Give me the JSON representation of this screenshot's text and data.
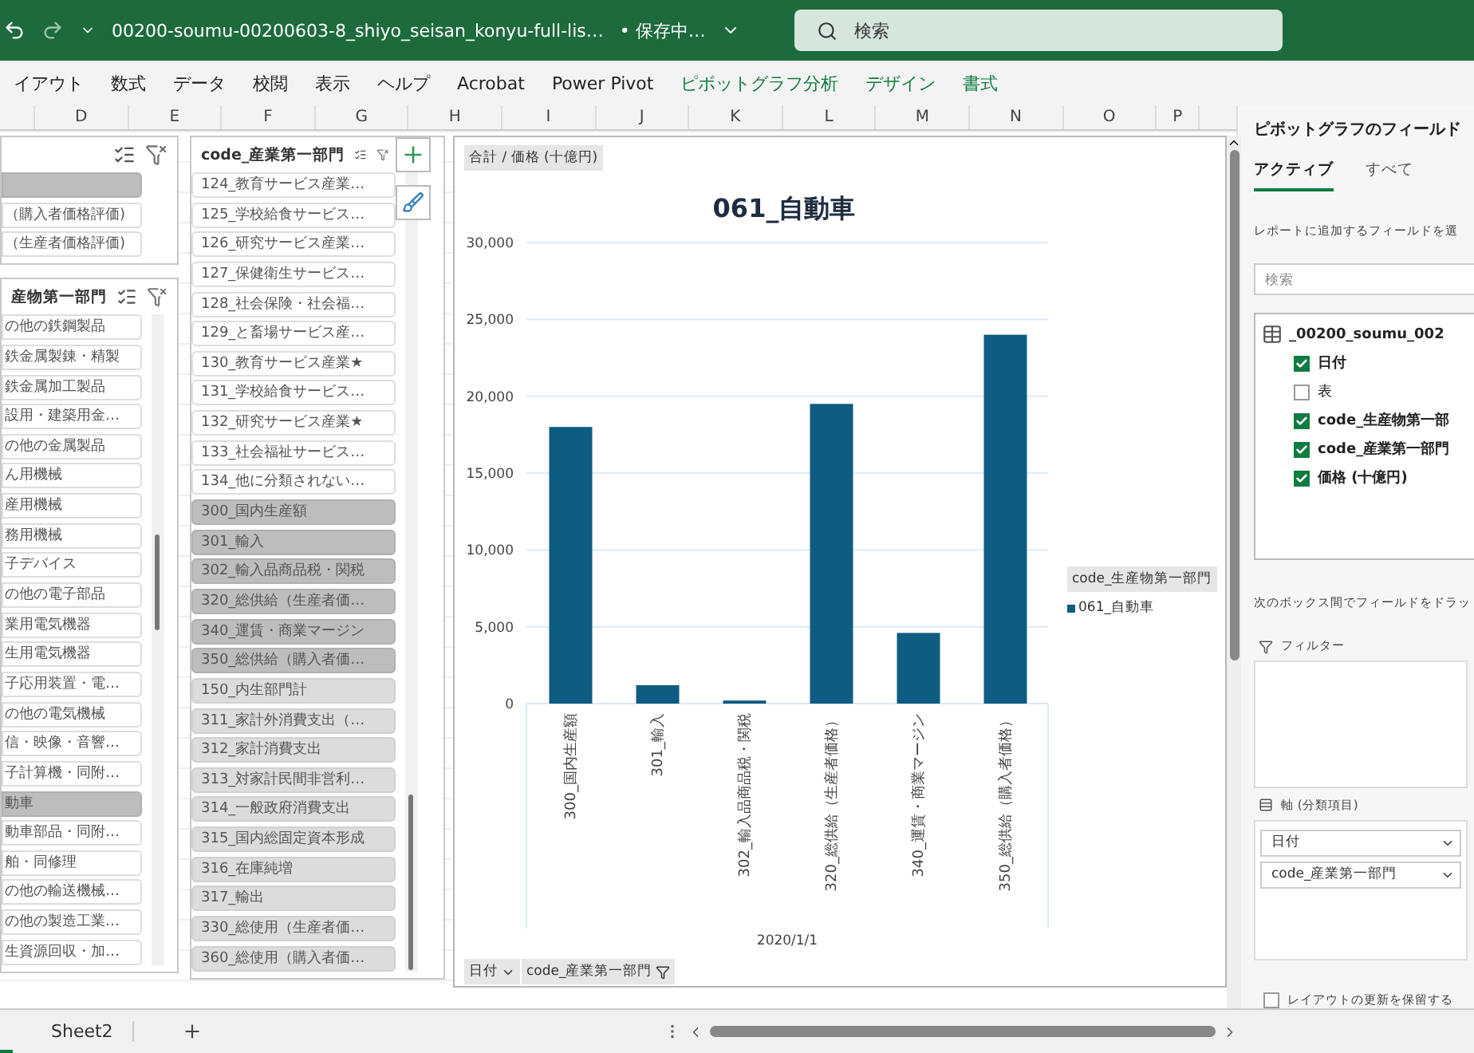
{
  "title_bar": {
    "file_name": "00200-soumu-00200603-8_shiyo_seisan_konyu-full-lis…",
    "save_status": "• 保存中…",
    "search_placeholder": "検索"
  },
  "ribbon_tabs": [
    {
      "label": "イアウト",
      "contextual": false
    },
    {
      "label": "数式",
      "contextual": false
    },
    {
      "label": "データ",
      "contextual": false
    },
    {
      "label": "校閲",
      "contextual": false
    },
    {
      "label": "表示",
      "contextual": false
    },
    {
      "label": "ヘルプ",
      "contextual": false
    },
    {
      "label": "Acrobat",
      "contextual": false
    },
    {
      "label": "Power Pivot",
      "contextual": false
    },
    {
      "label": "ピボットグラフ分析",
      "contextual": true
    },
    {
      "label": "デザイン",
      "contextual": true
    },
    {
      "label": "書式",
      "contextual": true
    }
  ],
  "column_headers": [
    "D",
    "E",
    "F",
    "G",
    "H",
    "I",
    "J",
    "K",
    "L",
    "M",
    "N",
    "O",
    "P"
  ],
  "slicers": [
    {
      "items": [
        {
          "selected": true,
          "has_data": true
        },
        {
          "label": "（購入者価格評価)",
          "selected": false,
          "has_data": true
        },
        {
          "label": "（生産者価格評価)",
          "selected": false,
          "has_data": true
        }
      ]
    },
    {
      "header": "産物第一部門",
      "items": [
        {
          "label": "の他の鉄鋼製品",
          "selected": false,
          "has_data": true
        },
        {
          "label": "鉄金属製錬・精製",
          "selected": false,
          "has_data": true
        },
        {
          "label": "鉄金属加工製品",
          "selected": false,
          "has_data": true
        },
        {
          "label": "設用・建築用金…",
          "selected": false,
          "has_data": true
        },
        {
          "label": "の他の金属製品",
          "selected": false,
          "has_data": true
        },
        {
          "label": "ん用機械",
          "selected": false,
          "has_data": true
        },
        {
          "label": "産用機械",
          "selected": false,
          "has_data": true
        },
        {
          "label": "務用機械",
          "selected": false,
          "has_data": true
        },
        {
          "label": "子デバイス",
          "selected": false,
          "has_data": true
        },
        {
          "label": "の他の電子部品",
          "selected": false,
          "has_data": true
        },
        {
          "label": "業用電気機器",
          "selected": false,
          "has_data": true
        },
        {
          "label": "生用電気機器",
          "selected": false,
          "has_data": true
        },
        {
          "label": "子応用装置・電…",
          "selected": false,
          "has_data": true
        },
        {
          "label": "の他の電気機械",
          "selected": false,
          "has_data": true
        },
        {
          "label": "信・映像・音響…",
          "selected": false,
          "has_data": true
        },
        {
          "label": "子計算機・同附…",
          "selected": false,
          "has_data": true
        },
        {
          "label": "動車",
          "selected": true,
          "has_data": true
        },
        {
          "label": "動車部品・同附…",
          "selected": false,
          "has_data": true
        },
        {
          "label": "舶・同修理",
          "selected": false,
          "has_data": true
        },
        {
          "label": "の他の輸送機械…",
          "selected": false,
          "has_data": true
        },
        {
          "label": "の他の製造工業…",
          "selected": false,
          "has_data": true
        },
        {
          "label": "生資源回収・加…",
          "selected": false,
          "has_data": true
        }
      ]
    },
    {
      "header": "code_産業第一部門",
      "items": [
        {
          "label": "124_教育サービス産業…",
          "selected": false,
          "has_data": true
        },
        {
          "label": "125_学校給食サービス…",
          "selected": false,
          "has_data": true
        },
        {
          "label": "126_研究サービス産業…",
          "selected": false,
          "has_data": true
        },
        {
          "label": "127_保健衛生サービス…",
          "selected": false,
          "has_data": true
        },
        {
          "label": "128_社会保険・社会福…",
          "selected": false,
          "has_data": true
        },
        {
          "label": "129_と畜場サービス産…",
          "selected": false,
          "has_data": true
        },
        {
          "label": "130_教育サービス産業★",
          "selected": false,
          "has_data": true
        },
        {
          "label": "131_学校給食サービス…",
          "selected": false,
          "has_data": true
        },
        {
          "label": "132_研究サービス産業★",
          "selected": false,
          "has_data": true
        },
        {
          "label": "133_社会福祉サービス…",
          "selected": false,
          "has_data": true
        },
        {
          "label": "134_他に分類されない…",
          "selected": false,
          "has_data": true
        },
        {
          "label": "300_国内生産額",
          "selected": true,
          "has_data": true
        },
        {
          "label": "301_輸入",
          "selected": true,
          "has_data": true
        },
        {
          "label": "302_輸入品商品税・関税",
          "selected": true,
          "has_data": true
        },
        {
          "label": "320_総供給（生産者価…",
          "selected": true,
          "has_data": true
        },
        {
          "label": "340_運賃・商業マージン",
          "selected": true,
          "has_data": true
        },
        {
          "label": "350_総供給（購入者価…",
          "selected": true,
          "has_data": true
        },
        {
          "label": "150_内生部門計",
          "selected": false,
          "has_data": false
        },
        {
          "label": "311_家計外消費支出（…",
          "selected": false,
          "has_data": false
        },
        {
          "label": "312_家計消費支出",
          "selected": false,
          "has_data": false
        },
        {
          "label": "313_対家計民間非営利…",
          "selected": false,
          "has_data": false
        },
        {
          "label": "314_一般政府消費支出",
          "selected": false,
          "has_data": false
        },
        {
          "label": "315_国内総固定資本形成",
          "selected": false,
          "has_data": false
        },
        {
          "label": "316_在庫純増",
          "selected": false,
          "has_data": false
        },
        {
          "label": "317_輸出",
          "selected": false,
          "has_data": false
        },
        {
          "label": "330_総使用（生産者価…",
          "selected": false,
          "has_data": false
        },
        {
          "label": "360_総使用（購入者価…",
          "selected": false,
          "has_data": false
        }
      ]
    }
  ],
  "chart": {
    "value_field_button": "合計 / 価格 (十億円)",
    "legend_title": "code_生産物第一部門",
    "axis_field_buttons": [
      "日付",
      "code_産業第一部門"
    ],
    "chart_data": {
      "type": "bar",
      "title": "061_自動車",
      "xlabel": "2020/1/1",
      "categories": [
        "300_国内生産額",
        "301_輸入",
        "302_輸入品商品税・関税",
        "320_総供給（生産者価格）",
        "340_運賃・商業マージン",
        "350_総供給（購入者価格）"
      ],
      "series": [
        {
          "name": "061_自動車",
          "color": "#0f5c82",
          "values": [
            18000,
            1200,
            200,
            19500,
            4600,
            24000
          ]
        }
      ],
      "grid": true,
      "ylim": [
        0,
        30000
      ],
      "yticks": [
        {
          "value": 0,
          "label": "0"
        },
        {
          "value": 5000,
          "label": "5,000"
        },
        {
          "value": 10000,
          "label": "10,000"
        },
        {
          "value": 15000,
          "label": "15,000"
        },
        {
          "value": 20000,
          "label": "20,000"
        },
        {
          "value": 25000,
          "label": "25,000"
        },
        {
          "value": 30000,
          "label": "30,000"
        }
      ]
    }
  },
  "field_pane": {
    "title": "ピボットグラフのフィールド",
    "tabs": [
      {
        "label": "アクティブ",
        "selected": true
      },
      {
        "label": "すべて",
        "selected": false
      }
    ],
    "instruction": "レポートに追加するフィールドを選",
    "search_placeholder": "検索",
    "table_name": "_00200_soumu_002",
    "fields": [
      {
        "label": "日付",
        "checked": true
      },
      {
        "label": "表",
        "checked": false
      },
      {
        "label": "code_生産物第一部",
        "checked": true
      },
      {
        "label": "code_産業第一部門",
        "checked": true
      },
      {
        "label": "価格 (十億円)",
        "checked": true
      }
    ],
    "drag_hint": "次のボックス間でフィールドをドラッ",
    "filter_area": "フィルター",
    "axis_area": "軸 (分類項目)",
    "axis_fields": [
      "日付",
      "code_産業第一部門"
    ],
    "defer_update": {
      "label": "レイアウトの更新を保留する",
      "checked": false
    }
  },
  "sheet_tabs": [
    {
      "label": "Sheet2",
      "selected": false
    }
  ]
}
